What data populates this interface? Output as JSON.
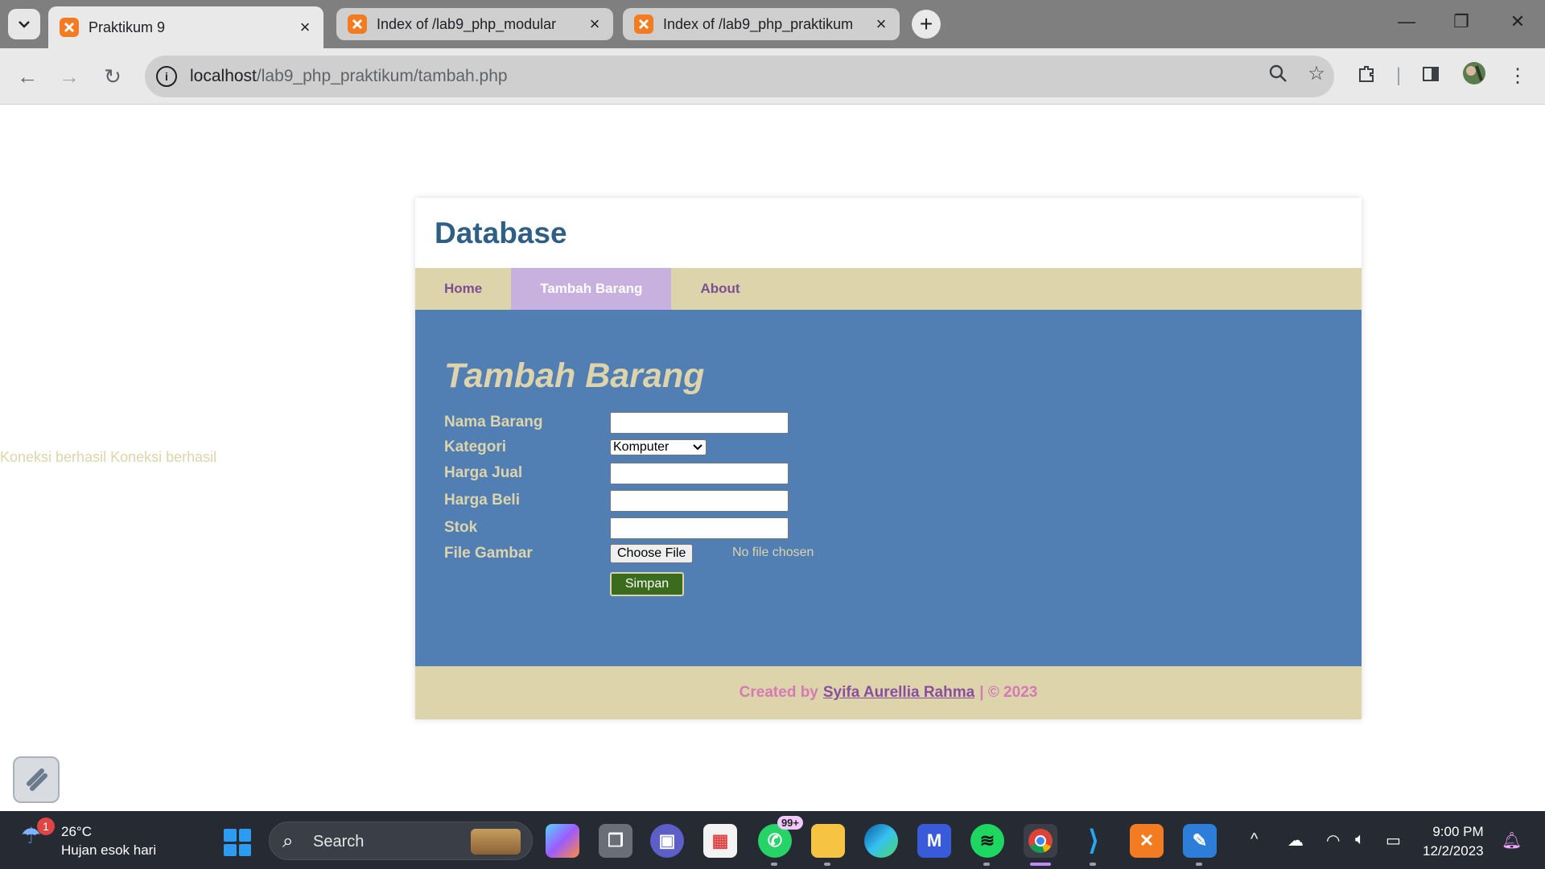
{
  "browser": {
    "tabs": [
      {
        "title": "Praktikum 9",
        "active": true
      },
      {
        "title": "Index of /lab9_php_modular",
        "active": false
      },
      {
        "title": "Index of /lab9_php_praktikum",
        "active": false
      }
    ],
    "url_host": "localhost",
    "url_path": "/lab9_php_praktikum/tambah.php"
  },
  "page": {
    "koneksi_text": "Koneksi berhasil Koneksi berhasil",
    "header_title": "Database",
    "nav": [
      {
        "label": "Home",
        "active": false
      },
      {
        "label": "Tambah Barang",
        "active": true
      },
      {
        "label": "About",
        "active": false
      }
    ],
    "form": {
      "heading": "Tambah Barang",
      "nama_barang_label": "Nama Barang",
      "nama_barang_value": "",
      "kategori_label": "Kategori",
      "kategori_selected": "Komputer",
      "harga_jual_label": "Harga Jual",
      "harga_jual_value": "",
      "harga_beli_label": "Harga Beli",
      "harga_beli_value": "",
      "stok_label": "Stok",
      "stok_value": "",
      "file_label": "File Gambar",
      "file_button": "Choose File",
      "file_status": "No file chosen",
      "submit_label": "Simpan"
    },
    "footer": {
      "prefix": "Created by",
      "author": "Syifa Aurellia Rahma",
      "suffix": "| © 2023"
    },
    "colors": {
      "header_text": "#2f5f86",
      "nav_bg": "#ddd4ac",
      "nav_active_bg": "#c8b1df",
      "content_bg": "#517fb3",
      "submit_bg": "#3b6b1c"
    }
  },
  "taskbar": {
    "weather_temp": "26°C",
    "weather_desc": "Hujan esok hari",
    "weather_badge": "1",
    "search_label": "Search",
    "whatsapp_badge": "99+",
    "time": "9:00 PM",
    "date": "12/2/2023"
  }
}
